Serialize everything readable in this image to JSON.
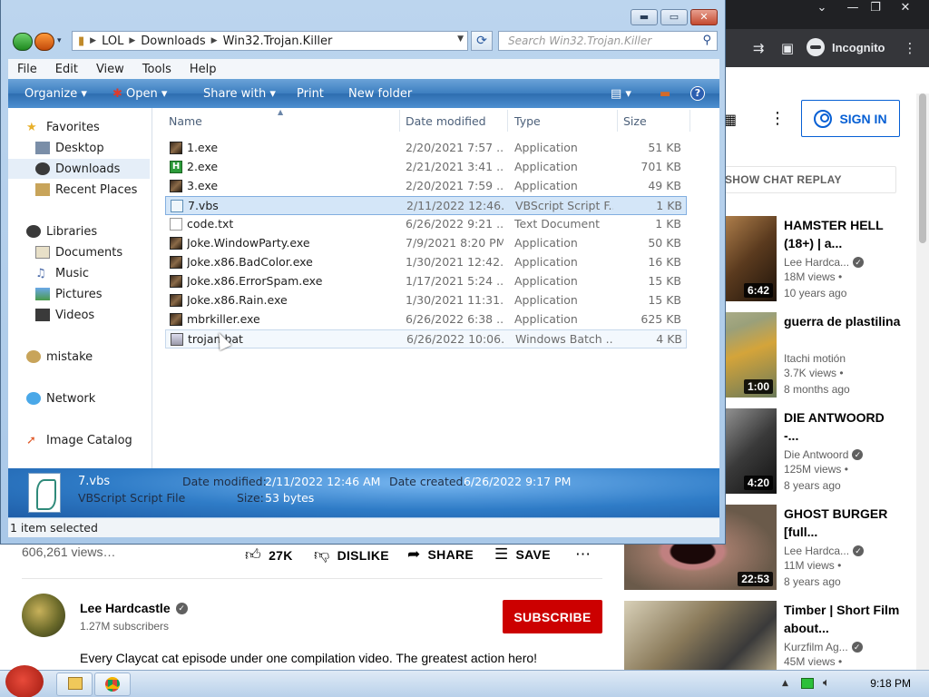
{
  "browser": {
    "incognito_label": "Incognito",
    "sign_in": "SIGN IN",
    "chat_replay": "SHOW CHAT REPLAY",
    "views": "606,261 views…",
    "actions": {
      "likes": "27K",
      "dislike": "DISLIKE",
      "share": "SHARE",
      "save": "SAVE"
    },
    "channel": {
      "name": "Lee Hardcastle",
      "subscribers": "1.27M subscribers",
      "subscribe": "SUBSCRIBE"
    },
    "description": "Every Claycat cat episode under one compilation video. The greatest action hero!",
    "recommendations": [
      {
        "title": "HAMSTER HELL (18+) | a...",
        "channel": "Lee Hardca...",
        "views": "18M views •",
        "age": "10 years ago",
        "duration": "6:42"
      },
      {
        "title": "guerra de plastilina",
        "channel": "Itachi motión",
        "views": "3.7K views •",
        "age": "8 months ago",
        "duration": "1:00"
      },
      {
        "title": "DIE ANTWOORD -...",
        "channel": "Die Antwoord",
        "views": "125M views •",
        "age": "8 years ago",
        "duration": "4:20"
      },
      {
        "title": "GHOST BURGER [full...",
        "channel": "Lee Hardca...",
        "views": "11M views •",
        "age": "8 years ago",
        "duration": "22:53"
      },
      {
        "title": "Timber | Short Film about...",
        "channel": "Kurzfilm Ag...",
        "views": "45M views •",
        "age": "",
        "duration": ""
      }
    ]
  },
  "explorer": {
    "path": [
      "LOL",
      "Downloads",
      "Win32.Trojan.Killer"
    ],
    "search_placeholder": "Search Win32.Trojan.Killer",
    "menu": [
      "File",
      "Edit",
      "View",
      "Tools",
      "Help"
    ],
    "commands": {
      "organize": "Organize",
      "open": "Open",
      "share": "Share with",
      "print": "Print",
      "new_folder": "New folder"
    },
    "nav": {
      "favorites": "Favorites",
      "desktop": "Desktop",
      "downloads": "Downloads",
      "recent": "Recent Places",
      "libraries": "Libraries",
      "documents": "Documents",
      "music": "Music",
      "pictures": "Pictures",
      "videos": "Videos",
      "mistake": "mistake",
      "network": "Network",
      "image_catalog": "Image Catalog"
    },
    "columns": {
      "name": "Name",
      "date": "Date modified",
      "type": "Type",
      "size": "Size"
    },
    "files": [
      {
        "name": "1.exe",
        "date": "2/20/2021 7:57 ...",
        "type": "Application",
        "size": "51 KB",
        "icon": "exe-icon"
      },
      {
        "name": "2.exe",
        "date": "2/21/2021 3:41 ...",
        "type": "Application",
        "size": "701 KB",
        "icon": "green-h-icon"
      },
      {
        "name": "3.exe",
        "date": "2/20/2021 7:59 ...",
        "type": "Application",
        "size": "49 KB",
        "icon": "exe-icon"
      },
      {
        "name": "7.vbs",
        "date": "2/11/2022 12:46...",
        "type": "VBScript Script F...",
        "size": "1 KB",
        "icon": "vbs-icon"
      },
      {
        "name": "code.txt",
        "date": "6/26/2022 9:21 ...",
        "type": "Text Document",
        "size": "1 KB",
        "icon": "txt-icon"
      },
      {
        "name": "Joke.WindowParty.exe",
        "date": "7/9/2021 8:20 PM",
        "type": "Application",
        "size": "50 KB",
        "icon": "exe-icon"
      },
      {
        "name": "Joke.x86.BadColor.exe",
        "date": "1/30/2021 12:42...",
        "type": "Application",
        "size": "16 KB",
        "icon": "exe-icon"
      },
      {
        "name": "Joke.x86.ErrorSpam.exe",
        "date": "1/17/2021 5:24 ...",
        "type": "Application",
        "size": "15 KB",
        "icon": "exe-icon"
      },
      {
        "name": "Joke.x86.Rain.exe",
        "date": "1/30/2021 11:31...",
        "type": "Application",
        "size": "15 KB",
        "icon": "exe-icon"
      },
      {
        "name": "mbrkiller.exe",
        "date": "6/26/2022 6:38 ...",
        "type": "Application",
        "size": "625 KB",
        "icon": "exe-icon"
      },
      {
        "name": "trojan.bat",
        "date": "6/26/2022 10:06...",
        "type": "Windows Batch ...",
        "size": "4 KB",
        "icon": "bat-icon"
      }
    ],
    "details": {
      "name": "7.vbs",
      "type": "VBScript Script File",
      "modified_label": "Date modified:",
      "modified": "2/11/2022 12:46 AM",
      "created_label": "Date created:",
      "created": "6/26/2022 9:17 PM",
      "size_label": "Size:",
      "size": "53 bytes"
    },
    "status": "1 item selected"
  },
  "taskbar": {
    "clock": "9:18 PM"
  }
}
